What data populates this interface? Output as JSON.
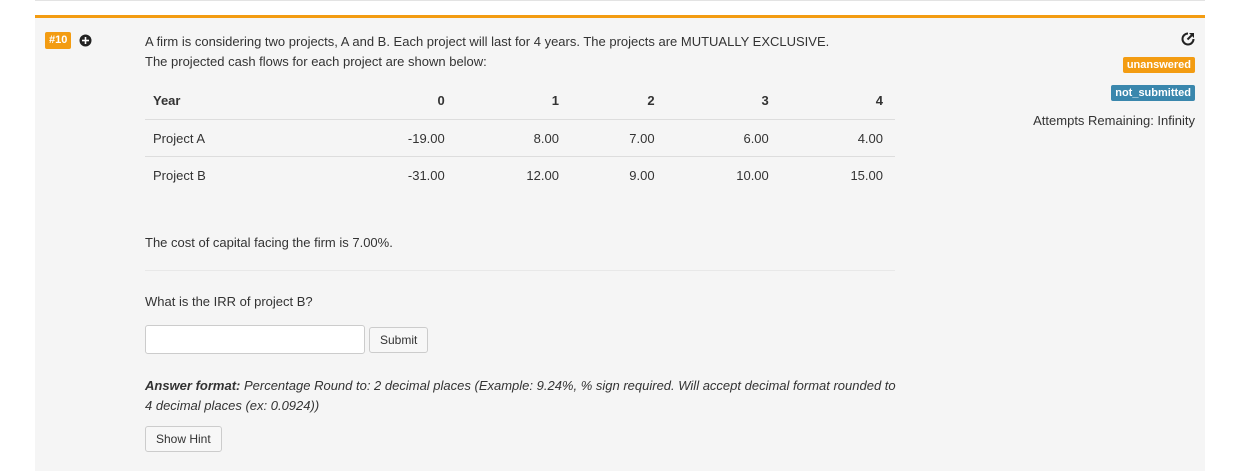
{
  "question": {
    "number": "#10",
    "intro_line1": "A firm is considering two projects, A and B. Each project will last for 4 years. The projects are MUTUALLY EXCLUSIVE.",
    "intro_line2": "The projected cash flows for each project are shown below:",
    "table": {
      "headers": [
        "Year",
        "0",
        "1",
        "2",
        "3",
        "4"
      ],
      "rows": [
        [
          "Project A",
          "-19.00",
          "8.00",
          "7.00",
          "6.00",
          "4.00"
        ],
        [
          "Project B",
          "-31.00",
          "12.00",
          "9.00",
          "10.00",
          "15.00"
        ]
      ]
    },
    "cost_text": "The cost of capital facing the firm is 7.00%.",
    "ask_text": "What is the IRR of project B?",
    "answer_value": "",
    "submit_label": "Submit",
    "format_label": "Answer format:",
    "format_text": " Percentage Round to: 2 decimal places (Example: 9.24%, % sign required. Will accept decimal format rounded to 4 decimal places (ex: 0.0924))",
    "hint_label": "Show Hint"
  },
  "status": {
    "answer_badge": "unanswered",
    "submit_badge": "not_submitted",
    "attempts": "Attempts Remaining: Infinity"
  },
  "colors": {
    "accent_orange": "#f39c12",
    "badge_blue": "#3a87ad",
    "panel_bg": "#f5f5f5"
  },
  "icons": {
    "expand": "plus-circle-icon",
    "share": "share-icon"
  }
}
